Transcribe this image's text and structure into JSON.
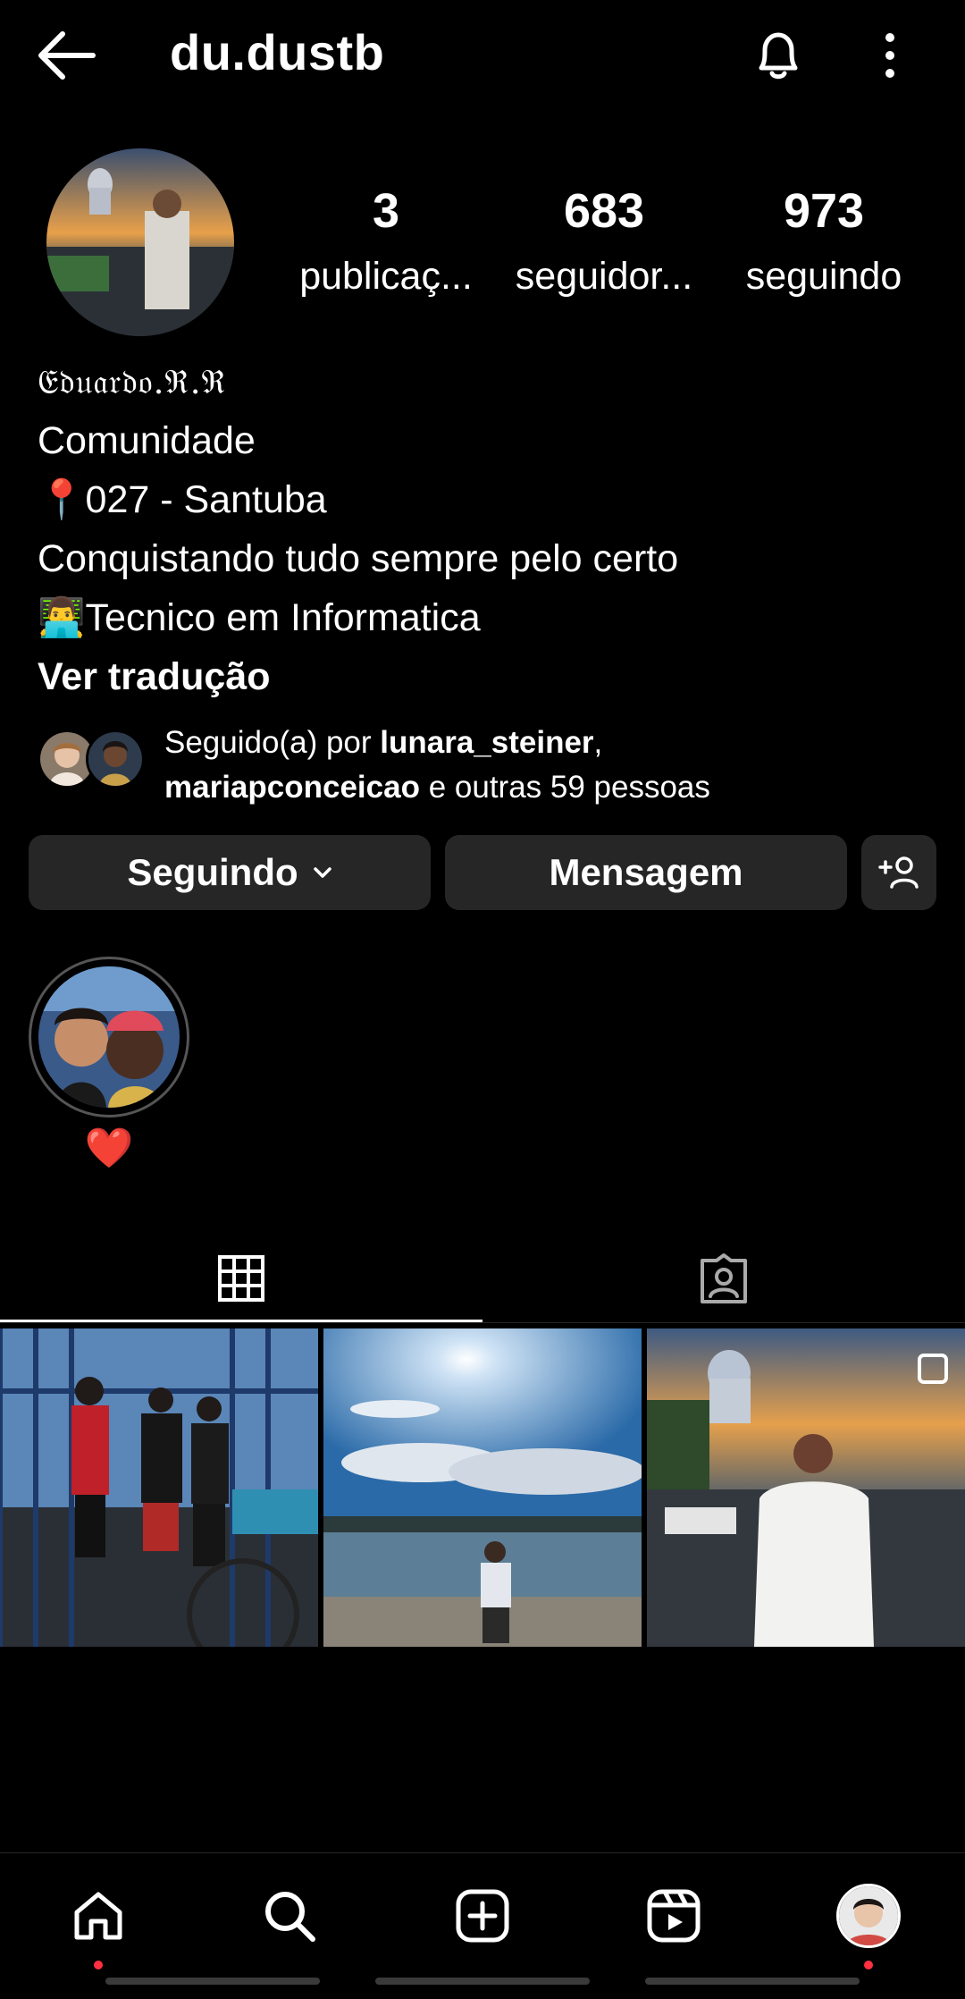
{
  "header": {
    "username": "du.dustb"
  },
  "stats": {
    "posts": {
      "value": "3",
      "label": "publicaç..."
    },
    "followers": {
      "value": "683",
      "label": "seguidor..."
    },
    "following": {
      "value": "973",
      "label": "seguindo"
    }
  },
  "bio": {
    "name": "𝔈𝔡𝔲𝔞𝔯𝔡𝔬.ℜ.ℜ",
    "category": "Comunidade",
    "lines": [
      "📍027 - Santuba",
      "Conquistando tudo sempre pelo certo",
      "👨‍💻Tecnico em Informatica"
    ],
    "translate": "Ver tradução"
  },
  "mutual": {
    "prefix": "Seguido(a) por ",
    "user1": "lunara_steiner",
    "comma": ",",
    "user2": "mariapconceicao",
    "suffix": " e outras 59 pessoas"
  },
  "buttons": {
    "following": "Seguindo",
    "message": "Mensagem"
  },
  "highlights": [
    {
      "label": "❤️"
    }
  ],
  "colors": {
    "background": "#000000",
    "button": "#262626",
    "notification_dot": "#ff3040"
  }
}
